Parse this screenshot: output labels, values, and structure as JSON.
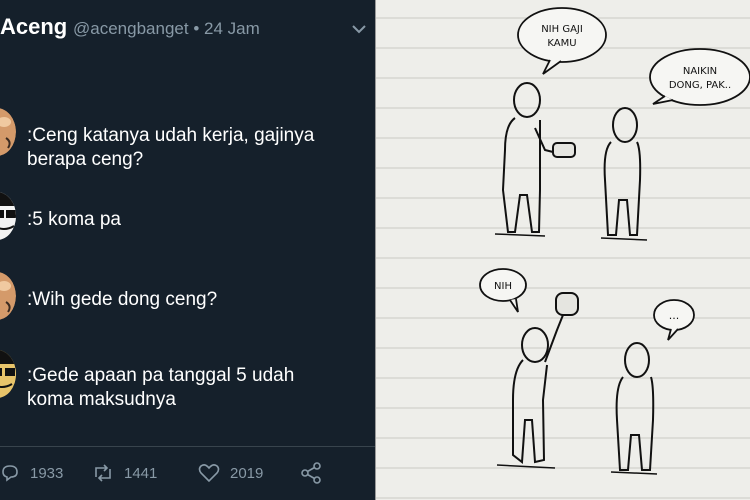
{
  "tweet": {
    "author_name": "Aceng",
    "handle": "@acengbanget",
    "separator": "•",
    "time": "24 Jam",
    "lines": [
      {
        "speaker": "father-avatar",
        "text_1": ":Ceng katanya udah kerja, gajinya",
        "text_2": "berapa ceng?"
      },
      {
        "speaker": "aceng-avatar",
        "text_1": ":5 koma pa",
        "text_2": ""
      },
      {
        "speaker": "father-avatar",
        "text_1": ":Wih gede dong ceng?",
        "text_2": ""
      },
      {
        "speaker": "aceng-avatar",
        "text_1": ":Gede apaan pa tanggal 5 udah",
        "text_2": "koma maksudnya"
      }
    ],
    "actions": {
      "reply_count": "1933",
      "retweet_count": "1441",
      "like_count": "2019"
    },
    "icons": [
      "chevron-down-icon",
      "reply-icon",
      "retweet-icon",
      "like-icon",
      "share-icon"
    ],
    "colors": {
      "background": "#15202b",
      "muted": "#8899a6",
      "text": "#ffffff"
    }
  },
  "comic": {
    "bubble_1": [
      "NIH GAJI",
      "KAMU"
    ],
    "bubble_2": [
      "NAIKIN",
      "DONG, PAK.."
    ],
    "bubble_3": "NIH",
    "bubble_4": "..."
  }
}
